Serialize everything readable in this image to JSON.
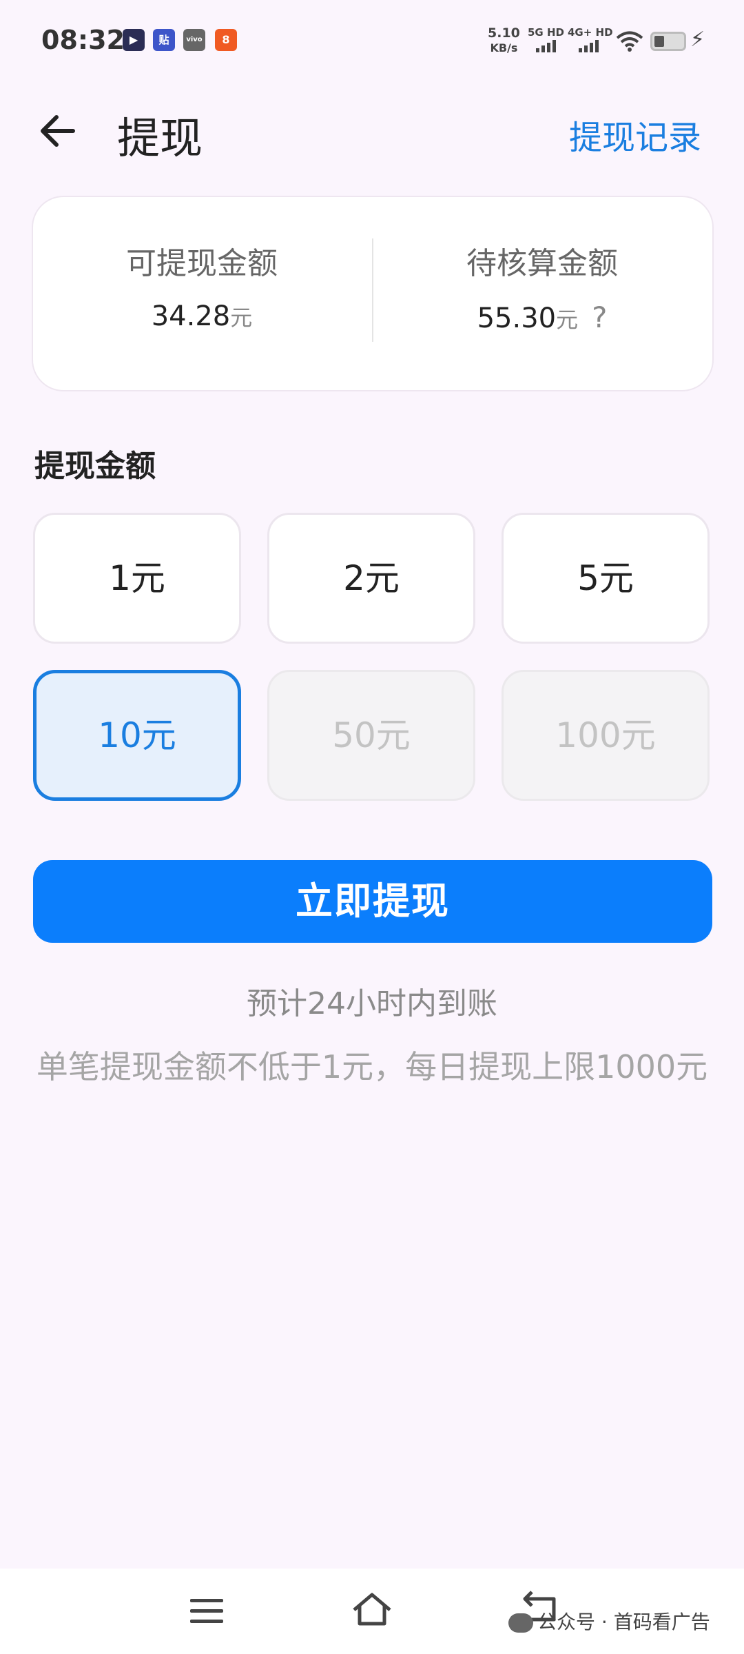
{
  "status_bar": {
    "time": "08:32",
    "net_speed_value": "5.10",
    "net_speed_unit": "KB/s",
    "sim1": "5G HD",
    "sim2": "4G+ HD",
    "apps": [
      {
        "icon": "video-app-icon",
        "glyph": "▶",
        "color": "#2b2d55"
      },
      {
        "icon": "tieba-app-icon",
        "glyph": "贴",
        "color": "#3d55c9"
      },
      {
        "icon": "vivo-app-icon",
        "glyph": "vivo",
        "color": "#666666"
      },
      {
        "icon": "orange-app-icon",
        "glyph": "8",
        "color": "#f05a23"
      }
    ]
  },
  "header": {
    "title": "提现",
    "record_link": "提现记录"
  },
  "balance_card": {
    "available_label": "可提现金额",
    "available_value": "34.28",
    "pending_label": "待核算金额",
    "pending_value": "55.30",
    "unit": "元",
    "help": "?"
  },
  "amount_section": {
    "label": "提现金额",
    "options": [
      {
        "label": "1元",
        "state": "normal"
      },
      {
        "label": "2元",
        "state": "normal"
      },
      {
        "label": "5元",
        "state": "normal"
      },
      {
        "label": "10元",
        "state": "selected"
      },
      {
        "label": "50元",
        "state": "disabled"
      },
      {
        "label": "100元",
        "state": "disabled"
      }
    ]
  },
  "cta": {
    "label": "立即提现"
  },
  "notes": {
    "arrival": "预计24小时内到账",
    "limit": "单笔提现金额不低于1元，每日提现上限1000元"
  },
  "watermark": {
    "text": "公众号 · 首码看广告"
  },
  "colors": {
    "accent": "#0b7efc",
    "link": "#1a7ee0",
    "background": "#fbf5fd"
  }
}
